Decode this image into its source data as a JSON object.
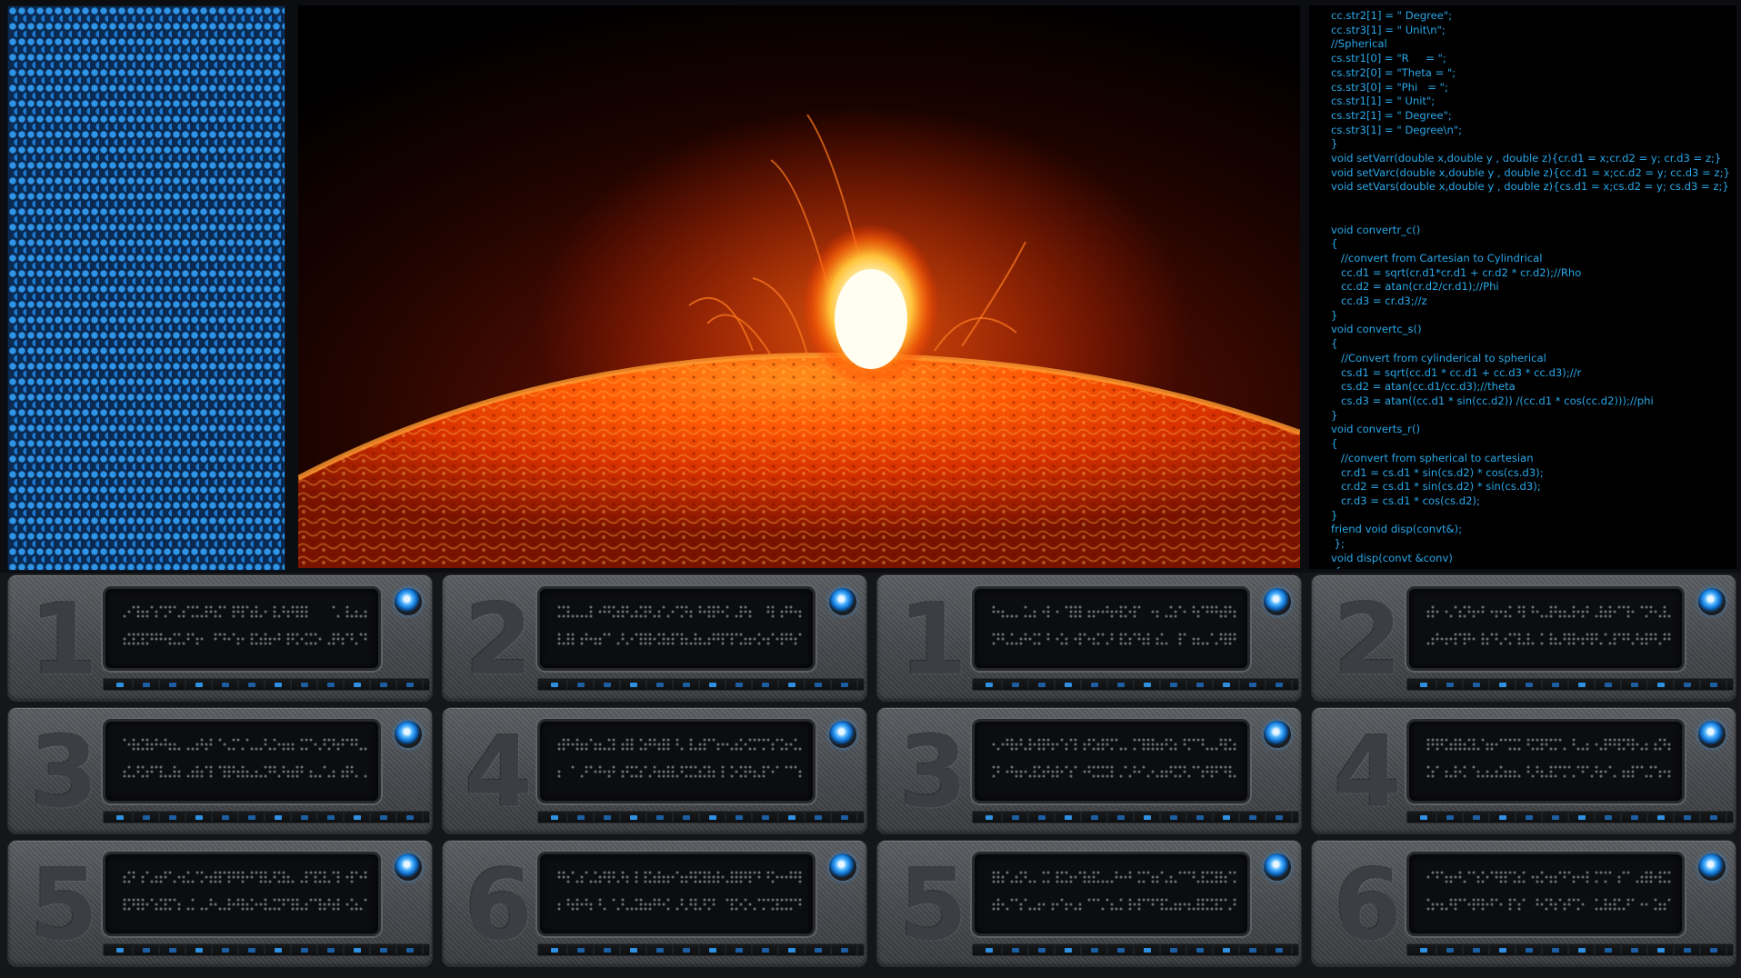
{
  "code_lines": [
    "cc.str2[1] = \" Degree\";",
    "cc.str3[1] = \" Unit\\n\";",
    "//Spherical",
    "cs.str1[0] = \"R     = \";",
    "cs.str2[0] = \"Theta = \";",
    "cs.str3[0] = \"Phi   = \";",
    "cs.str1[1] = \" Unit\";",
    "cs.str2[1] = \" Degree\";",
    "cs.str3[1] = \" Degree\\n\";",
    "}",
    "void setVarr(double x,double y , double z){cr.d1 = x;cr.d2 = y; cr.d3 = z;}",
    "void setVarc(double x,double y , double z){cc.d1 = x;cc.d2 = y; cc.d3 = z;}",
    "void setVars(double x,double y , double z){cs.d1 = x;cs.d2 = y; cs.d3 = z;}",
    "",
    "",
    "void convertr_c()",
    "{",
    "   //convert from Cartesian to Cylindrical",
    "   cc.d1 = sqrt(cr.d1*cr.d1 + cr.d2 * cr.d2);//Rho",
    "   cc.d2 = atan(cr.d2/cr.d1);//Phi",
    "   cc.d3 = cr.d3;//z",
    "}",
    "void convertc_s()",
    "{",
    "   //Convert from cylinderical to spherical",
    "   cs.d1 = sqrt(cc.d1 * cc.d1 + cc.d3 * cc.d3);//r",
    "   cs.d2 = atan(cc.d1/cc.d3);//theta",
    "   cs.d3 = atan((cc.d1 * sin(cc.d2)) /(cc.d1 * cos(cc.d2)));//phi",
    "}",
    "void converts_r()",
    "{",
    "   //convert from spherical to cartesian",
    "   cr.d1 = cs.d1 * sin(cs.d2) * cos(cs.d3);",
    "   cr.d2 = cs.d1 * sin(cs.d2) * sin(cs.d3);",
    "   cr.d3 = cs.d1 * cos(cs.d2);",
    "}",
    "friend void disp(convt&);",
    " };",
    "void disp(convt &conv)",
    " {"
  ],
  "rack_rows": [
    [
      "1",
      "2",
      "1",
      "2"
    ],
    [
      "3",
      "4",
      "3",
      "4"
    ],
    [
      "5",
      "6",
      "5",
      "6"
    ]
  ],
  "colors": {
    "code_text": "#2aa7e8",
    "hex_light": "#2f93e6",
    "led_blue": "#53b6ff"
  }
}
